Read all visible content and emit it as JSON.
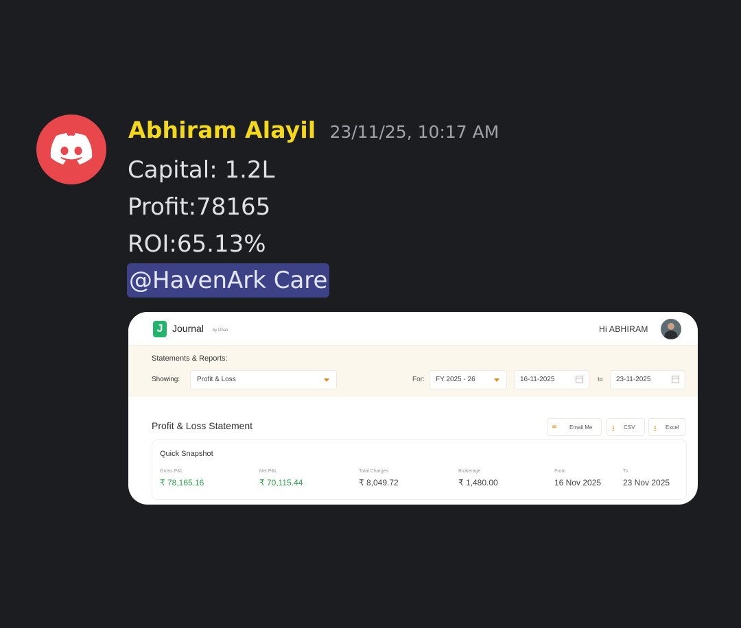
{
  "message": {
    "author": "Abhiram Alayil",
    "timestamp": "23/11/25, 10:17 AM",
    "lines": [
      "Capital: 1.2L",
      "Profit:78165",
      "ROI:65.13%"
    ],
    "mention": "@HavenArk Care",
    "author_color": "#f4d81c",
    "avatar_color": "#e8474b",
    "avatar_icon": "discord-icon"
  },
  "embed": {
    "brand": "Journal",
    "brand_sub": "by Dhan",
    "greeting": "Hi ABHIRAM",
    "statements_label": "Statements & Reports:",
    "showing_label": "Showing:",
    "report_type": "Profit & Loss",
    "for_label": "For:",
    "fy": "FY 2025 - 26",
    "date_from": "16-11-2025",
    "to_label": "to",
    "date_to": "23-11-2025",
    "statement_title": "Profit & Loss Statement",
    "buttons": {
      "email": "Email Me",
      "csv": "CSV",
      "excel": "Excel"
    },
    "snapshot": {
      "title": "Quick Snapshot",
      "metrics": [
        {
          "label": "Gross P&L",
          "value": "₹ 78,165.16"
        },
        {
          "label": "Net P&L",
          "value": "₹ 70,115.44"
        },
        {
          "label": "Total Charges",
          "value": "₹ 8,049.72"
        },
        {
          "label": "Brokerage",
          "value": "₹ 1,480.00"
        },
        {
          "label": "From",
          "value": "16 Nov 2025"
        },
        {
          "label": "To",
          "value": "23 Nov 2025"
        }
      ]
    },
    "accent_green": "#2ca04b",
    "accent_orange": "#e08a1e"
  }
}
